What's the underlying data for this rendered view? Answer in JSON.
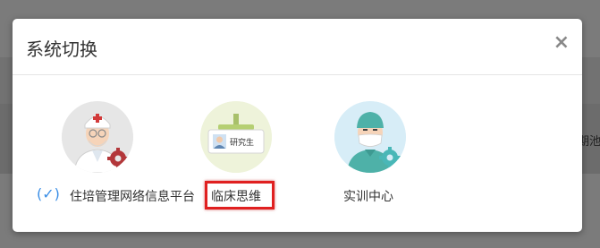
{
  "background": {
    "peek_text": "期池"
  },
  "modal": {
    "title": "系统切换",
    "close_glyph": "×"
  },
  "systems": [
    {
      "label": "住培管理网络信息平台",
      "icon": "doctor-gear-icon",
      "selected": true,
      "selected_mark": "(✓)"
    },
    {
      "label": "临床思维",
      "icon": "graduate-badge-icon",
      "selected": false,
      "badge_text": "研究生"
    },
    {
      "label": "实训中心",
      "icon": "surgeon-gear-icon",
      "selected": false
    }
  ],
  "colors": {
    "check": "#3a8ee6",
    "highlight": "#e02020",
    "gear_red": "#b3373a",
    "gear_teal": "#49b7b7"
  }
}
